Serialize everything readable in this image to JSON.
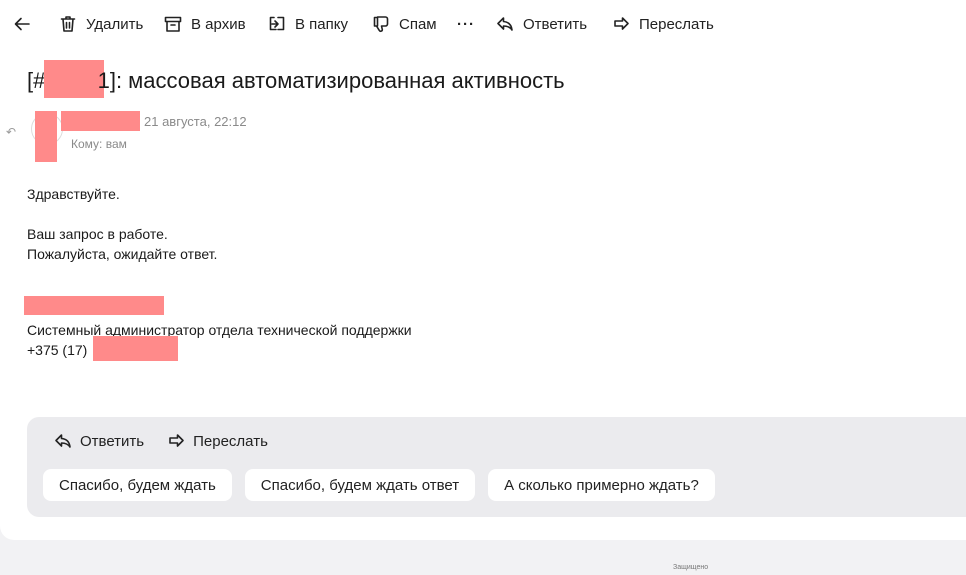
{
  "toolbar": {
    "back_icon": "arrow-left-icon",
    "delete_label": "Удалить",
    "archive_label": "В архив",
    "folder_label": "В папку",
    "spam_label": "Спам",
    "more_label": "···",
    "reply_label": "Ответить",
    "forward_label": "Переслать"
  },
  "message": {
    "subject_prefix": "[#5",
    "subject_mid": "1",
    "subject_suffix": "]: массовая автоматизированная активность",
    "date": "21 августа, 22:12",
    "to_line": "Кому: вам",
    "body_lines": {
      "greeting": "Здравствуйте.",
      "line1": "Ваш запрос в работе.",
      "line2": "Пожалуйста, ожидайте ответ.",
      "signature_title": "Системный администратор отдела технической поддержки",
      "phone_prefix": "+375 (17)"
    }
  },
  "reply_panel": {
    "reply_label": "Ответить",
    "forward_label": "Переслать",
    "quick_replies": [
      "Спасибо, будем ждать",
      "Спасибо, будем ждать ответ",
      "А сколько примерно ждать?"
    ]
  },
  "footer": {
    "note": "Защищено"
  }
}
